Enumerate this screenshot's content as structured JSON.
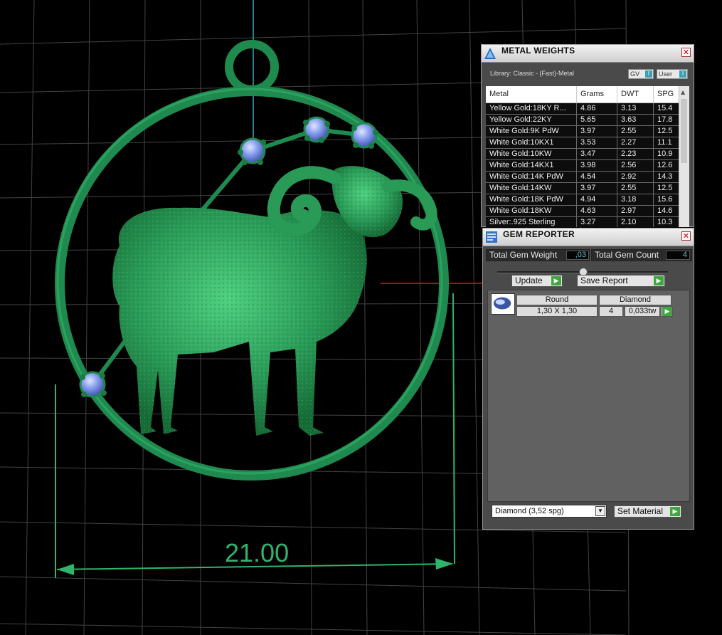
{
  "viewport": {
    "dimension_label": "21.00",
    "model_color": "#2a9a57"
  },
  "metal_weights": {
    "title": "METAL WEIGHTS",
    "library_label": "Library: Classic - (Fast)-Metal",
    "toggle_gv": "GV",
    "toggle_user": "User",
    "columns": [
      "Metal",
      "Grams",
      "DWT",
      "SPG"
    ],
    "rows": [
      {
        "metal": "Yellow Gold:18KY R...",
        "grams": "4.86",
        "dwt": "3.13",
        "spg": "15.4"
      },
      {
        "metal": "Yellow Gold:22KY",
        "grams": "5.65",
        "dwt": "3.63",
        "spg": "17.8"
      },
      {
        "metal": "White Gold:9K PdW",
        "grams": "3.97",
        "dwt": "2.55",
        "spg": "12.5"
      },
      {
        "metal": "White Gold:10KX1",
        "grams": "3.53",
        "dwt": "2.27",
        "spg": "11.1"
      },
      {
        "metal": "White Gold:10KW",
        "grams": "3.47",
        "dwt": "2.23",
        "spg": "10.9"
      },
      {
        "metal": "White Gold:14KX1",
        "grams": "3.98",
        "dwt": "2.56",
        "spg": "12.6"
      },
      {
        "metal": "White Gold:14K PdW",
        "grams": "4.54",
        "dwt": "2.92",
        "spg": "14.3"
      },
      {
        "metal": "White Gold:14KW",
        "grams": "3.97",
        "dwt": "2.55",
        "spg": "12.5"
      },
      {
        "metal": "White Gold:18K PdW",
        "grams": "4.94",
        "dwt": "3.18",
        "spg": "15.6"
      },
      {
        "metal": "White Gold:18KW",
        "grams": "4.63",
        "dwt": "2.97",
        "spg": "14.6"
      },
      {
        "metal": "Silver:.925 Sterling",
        "grams": "3.27",
        "dwt": "2.10",
        "spg": "10.3"
      }
    ]
  },
  "gem_reporter": {
    "title": "GEM REPORTER",
    "total_weight_label": "Total Gem Weight",
    "total_weight_value": ",03",
    "total_count_label": "Total Gem Count",
    "total_count_value": "4",
    "update_label": "Update",
    "save_report_label": "Save Report",
    "gem_shape": "Round",
    "gem_material": "Diamond",
    "gem_size": "1,30 X 1,30",
    "gem_qty": "4",
    "gem_weight": "0,033tw",
    "material_select": "Diamond       (3,52 spg)",
    "set_material_label": "Set Material"
  }
}
